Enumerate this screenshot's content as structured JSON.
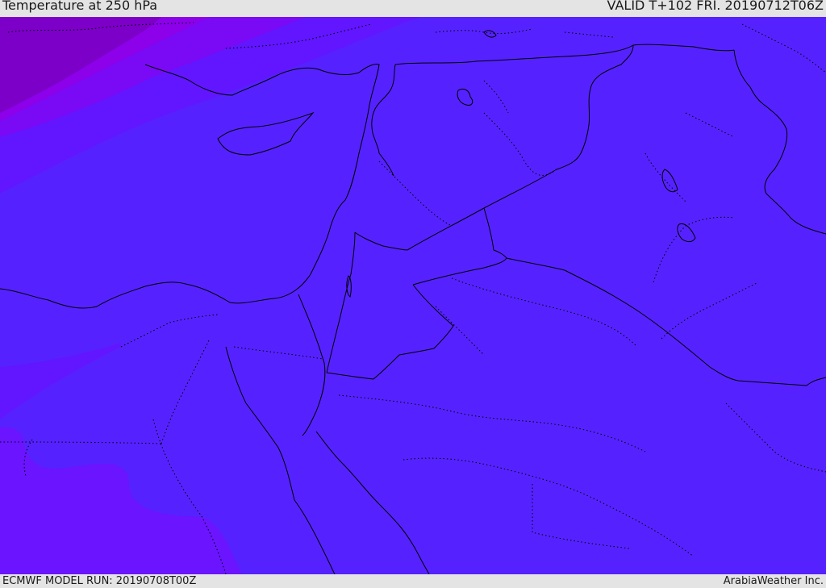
{
  "header": {
    "title": "Temperature at 250 hPa",
    "valid": "VALID T+102 FRI. 20190712T06Z"
  },
  "footer": {
    "model_run": "ECMWF MODEL RUN: 20190708T00Z",
    "credit": "ArabiaWeather Inc."
  },
  "colors": {
    "base_field": "#5522ff",
    "warmer_band": "#6116ff",
    "band_violet": "#7a09f5",
    "band_deep": "#8c00ea",
    "band_darkest": "#7c00c8",
    "southwest_band": "#6a14ff",
    "coastline": "#000000",
    "border": "#000000",
    "internal_border": "#000000",
    "frame": "#e4e4e4"
  }
}
